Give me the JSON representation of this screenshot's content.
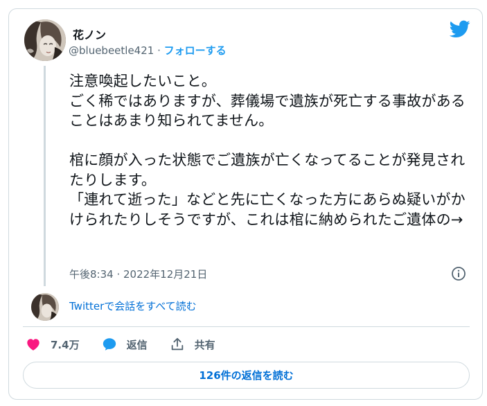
{
  "author": {
    "display_name": "花ノン",
    "handle": "@bluebeetle421",
    "separator": "·",
    "follow_label": "フォローする"
  },
  "tweet": {
    "text": "注意喚起したいこと。\nごく稀ではありますが、葬儀場で遺族が死亡する事故があることはあまり知られてません。\n\n棺に顔が入った状態でご遺族が亡くなってることが発見されたりします。\n「連れて逝った」などと先に亡くなった方にあらぬ疑いがかけられたりしそうですが、これは棺に納められたご遺体の→",
    "timestamp": "午後8:34 · 2022年12月21日"
  },
  "conversation_link": "Twitterで会話をすべて読む",
  "actions": {
    "likes": "7.4万",
    "reply_label": "返信",
    "share_label": "共有"
  },
  "read_replies_label": "126件の返信を読む",
  "colors": {
    "accent": "#1d9bf0",
    "like": "#f91880",
    "secondary_text": "#536471",
    "border": "#cfd9de"
  }
}
